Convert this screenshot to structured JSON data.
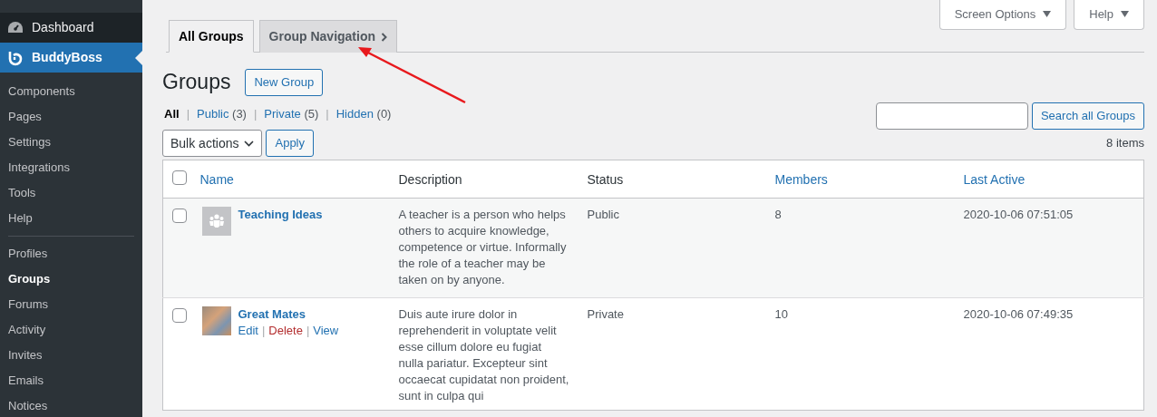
{
  "sidebar": {
    "top_items": [
      {
        "label": "Dashboard",
        "selected": false
      },
      {
        "label": "BuddyBoss",
        "selected": true
      }
    ],
    "submenu": [
      {
        "label": "Components",
        "selected": false
      },
      {
        "label": "Pages",
        "selected": false
      },
      {
        "label": "Settings",
        "selected": false
      },
      {
        "label": "Integrations",
        "selected": false
      },
      {
        "label": "Tools",
        "selected": false
      },
      {
        "label": "Help",
        "selected": false
      },
      {
        "kind": "separator"
      },
      {
        "label": "Profiles",
        "selected": false
      },
      {
        "label": "Groups",
        "selected": true
      },
      {
        "label": "Forums",
        "selected": false
      },
      {
        "label": "Activity",
        "selected": false
      },
      {
        "label": "Invites",
        "selected": false
      },
      {
        "label": "Emails",
        "selected": false
      },
      {
        "label": "Notices",
        "selected": false
      }
    ]
  },
  "screen_meta": [
    "Screen Options",
    "Help"
  ],
  "tabs": [
    {
      "label": "All Groups",
      "selected": true,
      "chevron": false
    },
    {
      "label": "Group Navigation",
      "selected": false,
      "chevron": true
    }
  ],
  "heading": "Groups",
  "new_button": "New Group",
  "filters": [
    {
      "label": "All",
      "selected": true
    },
    {
      "separator": "|",
      "label": "Public",
      "count": "(3)",
      "selected": false
    },
    {
      "separator": "|",
      "label": "Private",
      "count": "(5)",
      "selected": false
    },
    {
      "separator": "|",
      "label": "Hidden",
      "count": "(0)",
      "selected": false
    }
  ],
  "search_button": "Search all Groups",
  "bulk_actions": "Bulk actions",
  "apply": "Apply",
  "item_count": "8 items",
  "table": {
    "select_all_checked": false,
    "columns": [
      {
        "label": "Name",
        "sortable": true
      },
      {
        "label": "Description",
        "sortable": false
      },
      {
        "label": "Status",
        "sortable": false
      },
      {
        "label": "Members",
        "sortable": true
      },
      {
        "label": "Last Active",
        "sortable": true
      }
    ],
    "rows": [
      {
        "kind": "placeholder",
        "name": "Teaching Ideas",
        "actions": [],
        "description": "A teacher is a person who helps others to acquire knowledge, competence or virtue. Informally the role of a teacher may be taken on by anyone.",
        "status": "Public",
        "members": "8",
        "last_active": "2020-10-06 07:51:05",
        "checked": false
      },
      {
        "kind": "photo",
        "name": "Great Mates",
        "actions": [
          {
            "label": "Edit",
            "danger": false
          },
          {
            "separator": "|",
            "label": "Delete",
            "danger": true
          },
          {
            "separator": "|",
            "label": "View",
            "danger": false
          }
        ],
        "description": "Duis aute irure dolor in reprehenderit in voluptate velit esse cillum dolore eu fugiat nulla pariatur. Excepteur sint occaecat cupidatat non proident, sunt in culpa qui",
        "status": "Private",
        "members": "10",
        "last_active": "2020-10-06 07:49:35",
        "checked": false
      }
    ]
  }
}
